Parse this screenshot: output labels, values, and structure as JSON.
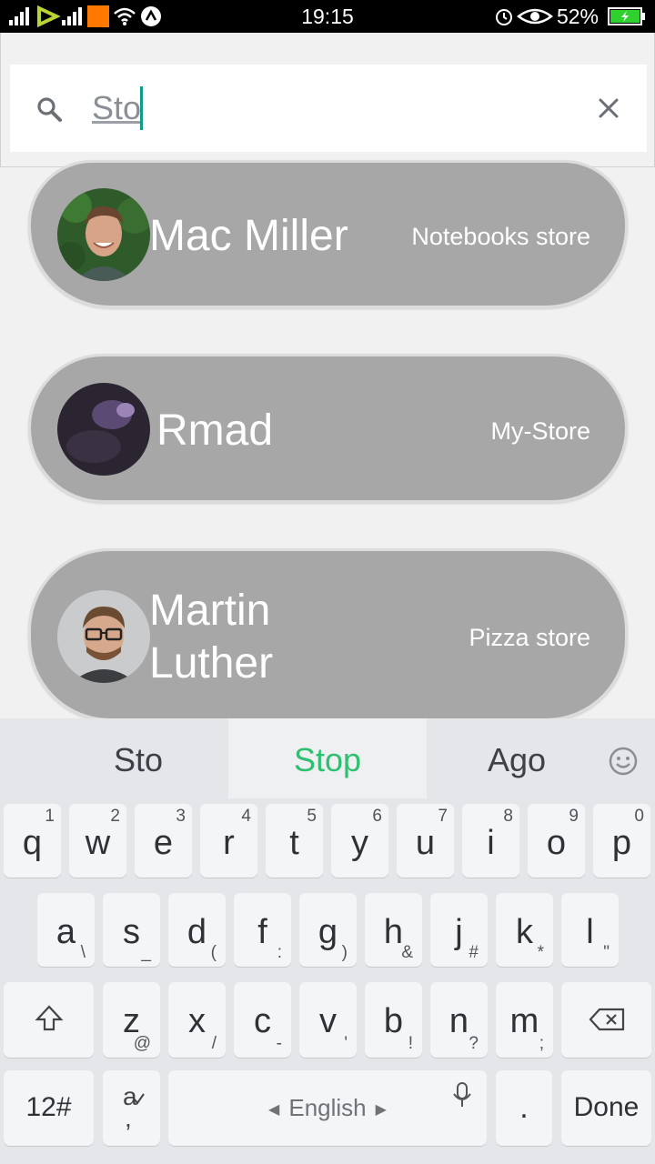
{
  "status_bar": {
    "time": "19:15",
    "battery_percent": "52%",
    "carrier_logo": "orange"
  },
  "search": {
    "query": "Sto",
    "placeholder": ""
  },
  "results": [
    {
      "name_line1": "Mac Miller",
      "name_line2": "",
      "store": "Notebooks store",
      "avatar": "man-smiling-avatar"
    },
    {
      "name_line1": "Rmad",
      "name_line2": "",
      "store": "My-Store",
      "avatar": "dark-purple-avatar"
    },
    {
      "name_line1": "Martin",
      "name_line2": "Luther",
      "store": "Pizza store",
      "avatar": "man-with-glasses-avatar"
    }
  ],
  "keyboard": {
    "suggestions": [
      "Sto",
      "Stop",
      "Ago"
    ],
    "row1": [
      {
        "k": "q",
        "s": "1"
      },
      {
        "k": "w",
        "s": "2"
      },
      {
        "k": "e",
        "s": "3"
      },
      {
        "k": "r",
        "s": "4"
      },
      {
        "k": "t",
        "s": "5"
      },
      {
        "k": "y",
        "s": "6"
      },
      {
        "k": "u",
        "s": "7"
      },
      {
        "k": "i",
        "s": "8"
      },
      {
        "k": "o",
        "s": "9"
      },
      {
        "k": "p",
        "s": "0"
      }
    ],
    "row2": [
      {
        "k": "a",
        "s": "\\"
      },
      {
        "k": "s",
        "s": "_"
      },
      {
        "k": "d",
        "s": "("
      },
      {
        "k": "f",
        "s": ":"
      },
      {
        "k": "g",
        "s": ")"
      },
      {
        "k": "h",
        "s": "&"
      },
      {
        "k": "j",
        "s": "#"
      },
      {
        "k": "k",
        "s": "*"
      },
      {
        "k": "l",
        "s": "\""
      }
    ],
    "row3": [
      {
        "k": "z",
        "s": "@"
      },
      {
        "k": "x",
        "s": "/"
      },
      {
        "k": "c",
        "s": "-"
      },
      {
        "k": "v",
        "s": "'"
      },
      {
        "k": "b",
        "s": "!"
      },
      {
        "k": "n",
        "s": "?"
      },
      {
        "k": "m",
        "s": ";"
      }
    ],
    "numbers_label": "12#",
    "space_label": "English",
    "period_label": ".",
    "done_label": "Done"
  }
}
